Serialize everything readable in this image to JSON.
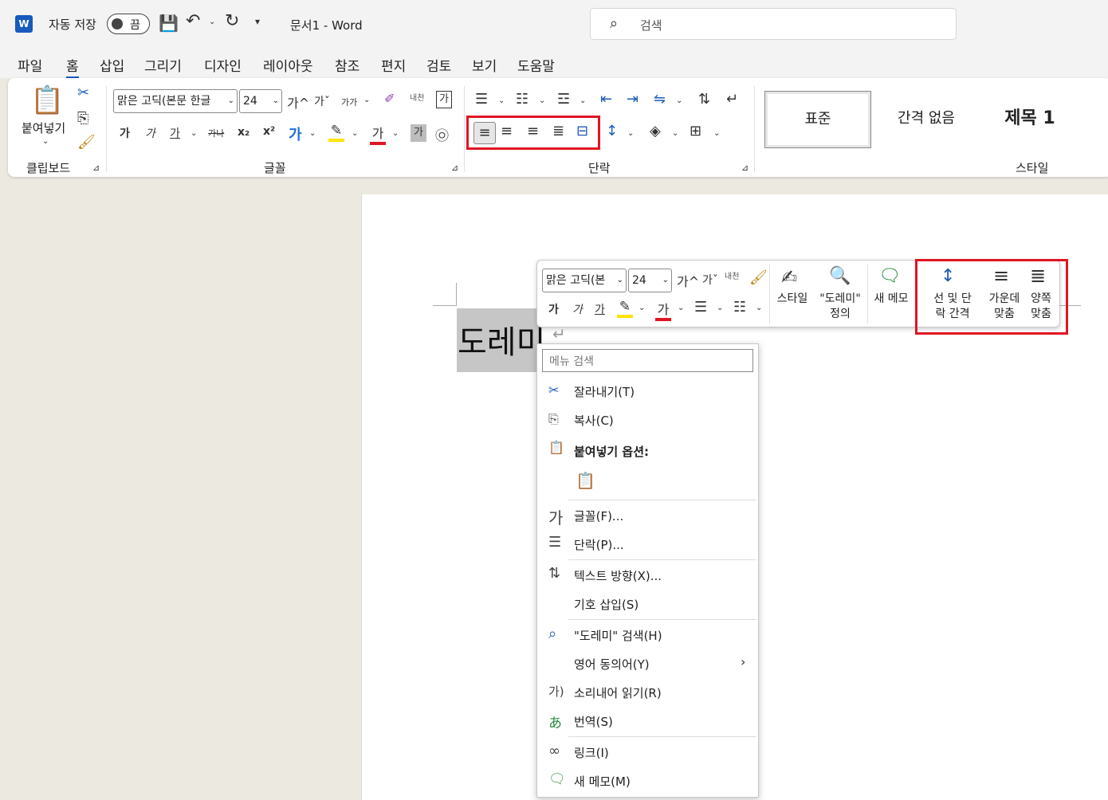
{
  "title_bar": {
    "app_icon": "word-icon",
    "autosave_label": "자동 저장",
    "autosave_state": "끔",
    "document_title": "문서1  -  Word",
    "search_placeholder": "검색"
  },
  "ribbon_tabs": [
    "파일",
    "홈",
    "삽입",
    "그리기",
    "디자인",
    "레이아웃",
    "참조",
    "편지",
    "검토",
    "보기",
    "도움말"
  ],
  "active_tab": "홈",
  "clipboard": {
    "paste_label": "붙여넣기",
    "group_label": "클립보드"
  },
  "font": {
    "font_name": "맑은 고딕(본문 한글",
    "font_size": "24",
    "grow": "가^",
    "shrink": "가ˇ",
    "case": "가가",
    "phonetic": "내천",
    "bold": "가",
    "italic": "가",
    "underline": "가",
    "strike": "가나",
    "sub": "x₂",
    "sup": "x²",
    "effects": "가",
    "color": "가",
    "shade": "가",
    "enclose": "㉧",
    "group_label": "글꼴"
  },
  "paragraph": {
    "group_label": "단락"
  },
  "styles": {
    "items": [
      "표준",
      "간격 없음",
      "제목 1"
    ],
    "group_label": "스타일"
  },
  "document": {
    "text": "도레미"
  },
  "mini_toolbar": {
    "font_name": "맑은 고딕(본",
    "font_size": "24",
    "style_label": "스타일",
    "define_label1": "\"도레미\"",
    "define_label2": "정의",
    "new_memo_label": "새 메모",
    "spacing_label1": "선 및 단",
    "spacing_label2": "락 간격",
    "center_label1": "가운데",
    "center_label2": "맞춤",
    "justify_label1": "양쪽",
    "justify_label2": "맞춤"
  },
  "context_menu": {
    "search_placeholder": "메뉴 검색",
    "items": [
      "잘라내기(T)",
      "복사(C)",
      "붙여넣기 옵션:",
      "글꼴(F)...",
      "단락(P)...",
      "텍스트 방향(X)...",
      "기호 삽입(S)",
      "\"도레미\" 검색(H)",
      "영어 동의어(Y)",
      "소리내어 읽기(R)",
      "번역(S)",
      "링크(I)",
      "새 메모(M)"
    ]
  },
  "colors": {
    "accent": "#185abd",
    "highlight_box": "#e01523",
    "font_color_bar": "#e01523",
    "highlight_bar": "#ffe400"
  }
}
